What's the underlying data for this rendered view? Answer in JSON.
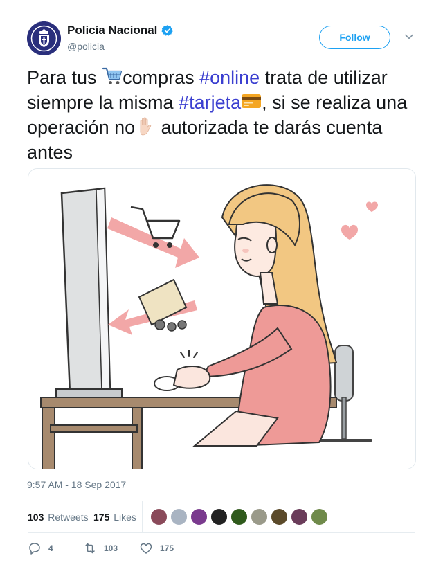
{
  "author": {
    "name": "Policía Nacional",
    "handle": "@policia",
    "verified": true
  },
  "follow_label": "Follow",
  "tweet": {
    "t1": "Para tus ",
    "t2": "compras ",
    "hashtag1": "#online",
    "t3": " trata de utilizar siempre la misma ",
    "hashtag2": "#tarjeta",
    "t4": ", si se realiza una operación no",
    "t5": " autorizada te darás cuenta antes"
  },
  "emojis": [
    "shopping-cart",
    "credit-card",
    "raised-hand"
  ],
  "timestamp": "9:57 AM - 18 Sep 2017",
  "stats": {
    "retweets_count": "103",
    "retweets_label": "Retweets",
    "likes_count": "175",
    "likes_label": "Likes"
  },
  "liker_colors": [
    "#8a4a5a",
    "#a9b4c2",
    "#7a3a8e",
    "#222222",
    "#2f5a1c",
    "#9a9a8a",
    "#5b4a2a",
    "#6a3c5a",
    "#6f8a4a"
  ],
  "actions": {
    "replies": "4",
    "retweets": "103",
    "likes": "175"
  },
  "colors": {
    "link": "#1da1f2",
    "hashtag": "#3b3fd0",
    "muted": "#657786"
  }
}
